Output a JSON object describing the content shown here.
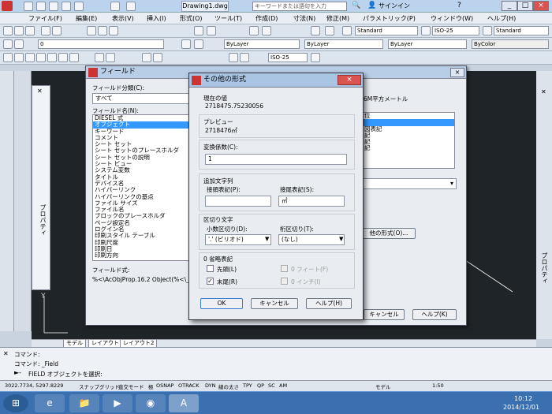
{
  "titlebar": {
    "document": "Drawing1.dwg",
    "search_placeholder": "キーワードまたは語句を入力",
    "signin": "サインイン"
  },
  "menu": [
    "ファイル(F)",
    "編集(E)",
    "表示(V)",
    "挿入(I)",
    "形式(O)",
    "ツール(T)",
    "作成(D)",
    "寸法(N)",
    "修正(M)",
    "パラメトリック(P)",
    "ウィンドウ(W)",
    "ヘルプ(H)"
  ],
  "toolbar": {
    "text_style": "Standard",
    "dim_style": "ISO-25",
    "table_style": "Standard",
    "layer": "0",
    "color": "ByLayer",
    "linetype": "ByLayer",
    "lineweight": "ByLayer",
    "plotstyle": "ByColor",
    "dim_style2": "ISO-25"
  },
  "field_dialog": {
    "title": "フィールド",
    "category_label": "フィールド分類(C):",
    "category_value": "すべて",
    "names_label": "フィールド名(N):",
    "names": [
      "DIESEL 式",
      "オブジェクト",
      "キーワード",
      "コメント",
      "シート セット",
      "シート セットのプレースホルダ",
      "シート セットの説明",
      "シート ビュー",
      "システム変数",
      "タイトル",
      "デバイス名",
      "ハイパーリンク",
      "ハイパーリンクの基点",
      "ファイル サイズ",
      "ファイル名",
      "ブロックのプレースホルダ",
      "ページ設定名",
      "ログイン名",
      "印刷スタイル テーブル",
      "印刷尺度",
      "印刷日",
      "印刷方向"
    ],
    "selected_name_index": 1,
    "right_header": "6M平方メートル",
    "right_list": [
      "位",
      "",
      "図表記",
      "記",
      "記",
      "記"
    ],
    "other_format_button": "他の形式(O)...",
    "expr_label": "フィールド式:",
    "expr_value": "%<\\AcObjProp.16.2 Object(%<\\_Ob",
    "cancel_button": "キャンセル",
    "help_button": "ヘルプ(K)"
  },
  "format_dialog": {
    "title": "その他の形式",
    "current_label": "現在の値",
    "current_value": "2718475.75230056",
    "preview_label": "プレビュー",
    "preview_value": "2718476㎡",
    "factor_label": "変換係数(C):",
    "factor_value": "1",
    "additional_label": "追加文字列",
    "prefix_label": "接頭表記(P):",
    "prefix_value": "",
    "suffix_label": "接尾表記(S):",
    "suffix_value": "㎡",
    "sep_label": "区切り文字",
    "decimal_label": "小数区切り(D):",
    "decimal_value": "'.' (ピリオド)",
    "thousands_label": "桁区切り(T):",
    "thousands_value": "(なし)",
    "zero_label": "0 省略表記",
    "leading_label": "先頭(L)",
    "trailing_label": "末尾(R)",
    "feet_label": "0 フィート(F)",
    "inches_label": "0 インチ(I)",
    "trailing_checked": true,
    "ok_button": "OK",
    "cancel_button": "キャンセル",
    "help_button": "ヘルプ(H)"
  },
  "layout_tabs": [
    "モデル",
    "レイアウト1",
    "レイアウト2"
  ],
  "command": {
    "line1": "コマンド:",
    "line2": "コマンド: _Field",
    "prompt": "FIELD オブジェクトを選択:"
  },
  "status": {
    "coords": "3022.7734, 5297.8229",
    "items": [
      "スナップ",
      "グリッド",
      "直交モード",
      "極",
      "OSNAP",
      "OTRACK",
      "DYN",
      "線の太さ",
      "TPY",
      "QP",
      "SC",
      "AM"
    ],
    "model": "モデル",
    "scale": "1:50",
    "properties": "プロパティ",
    "palette_label": "プロパティ"
  },
  "taskbar": {
    "time": "10:12",
    "date": "2014/12/01"
  }
}
